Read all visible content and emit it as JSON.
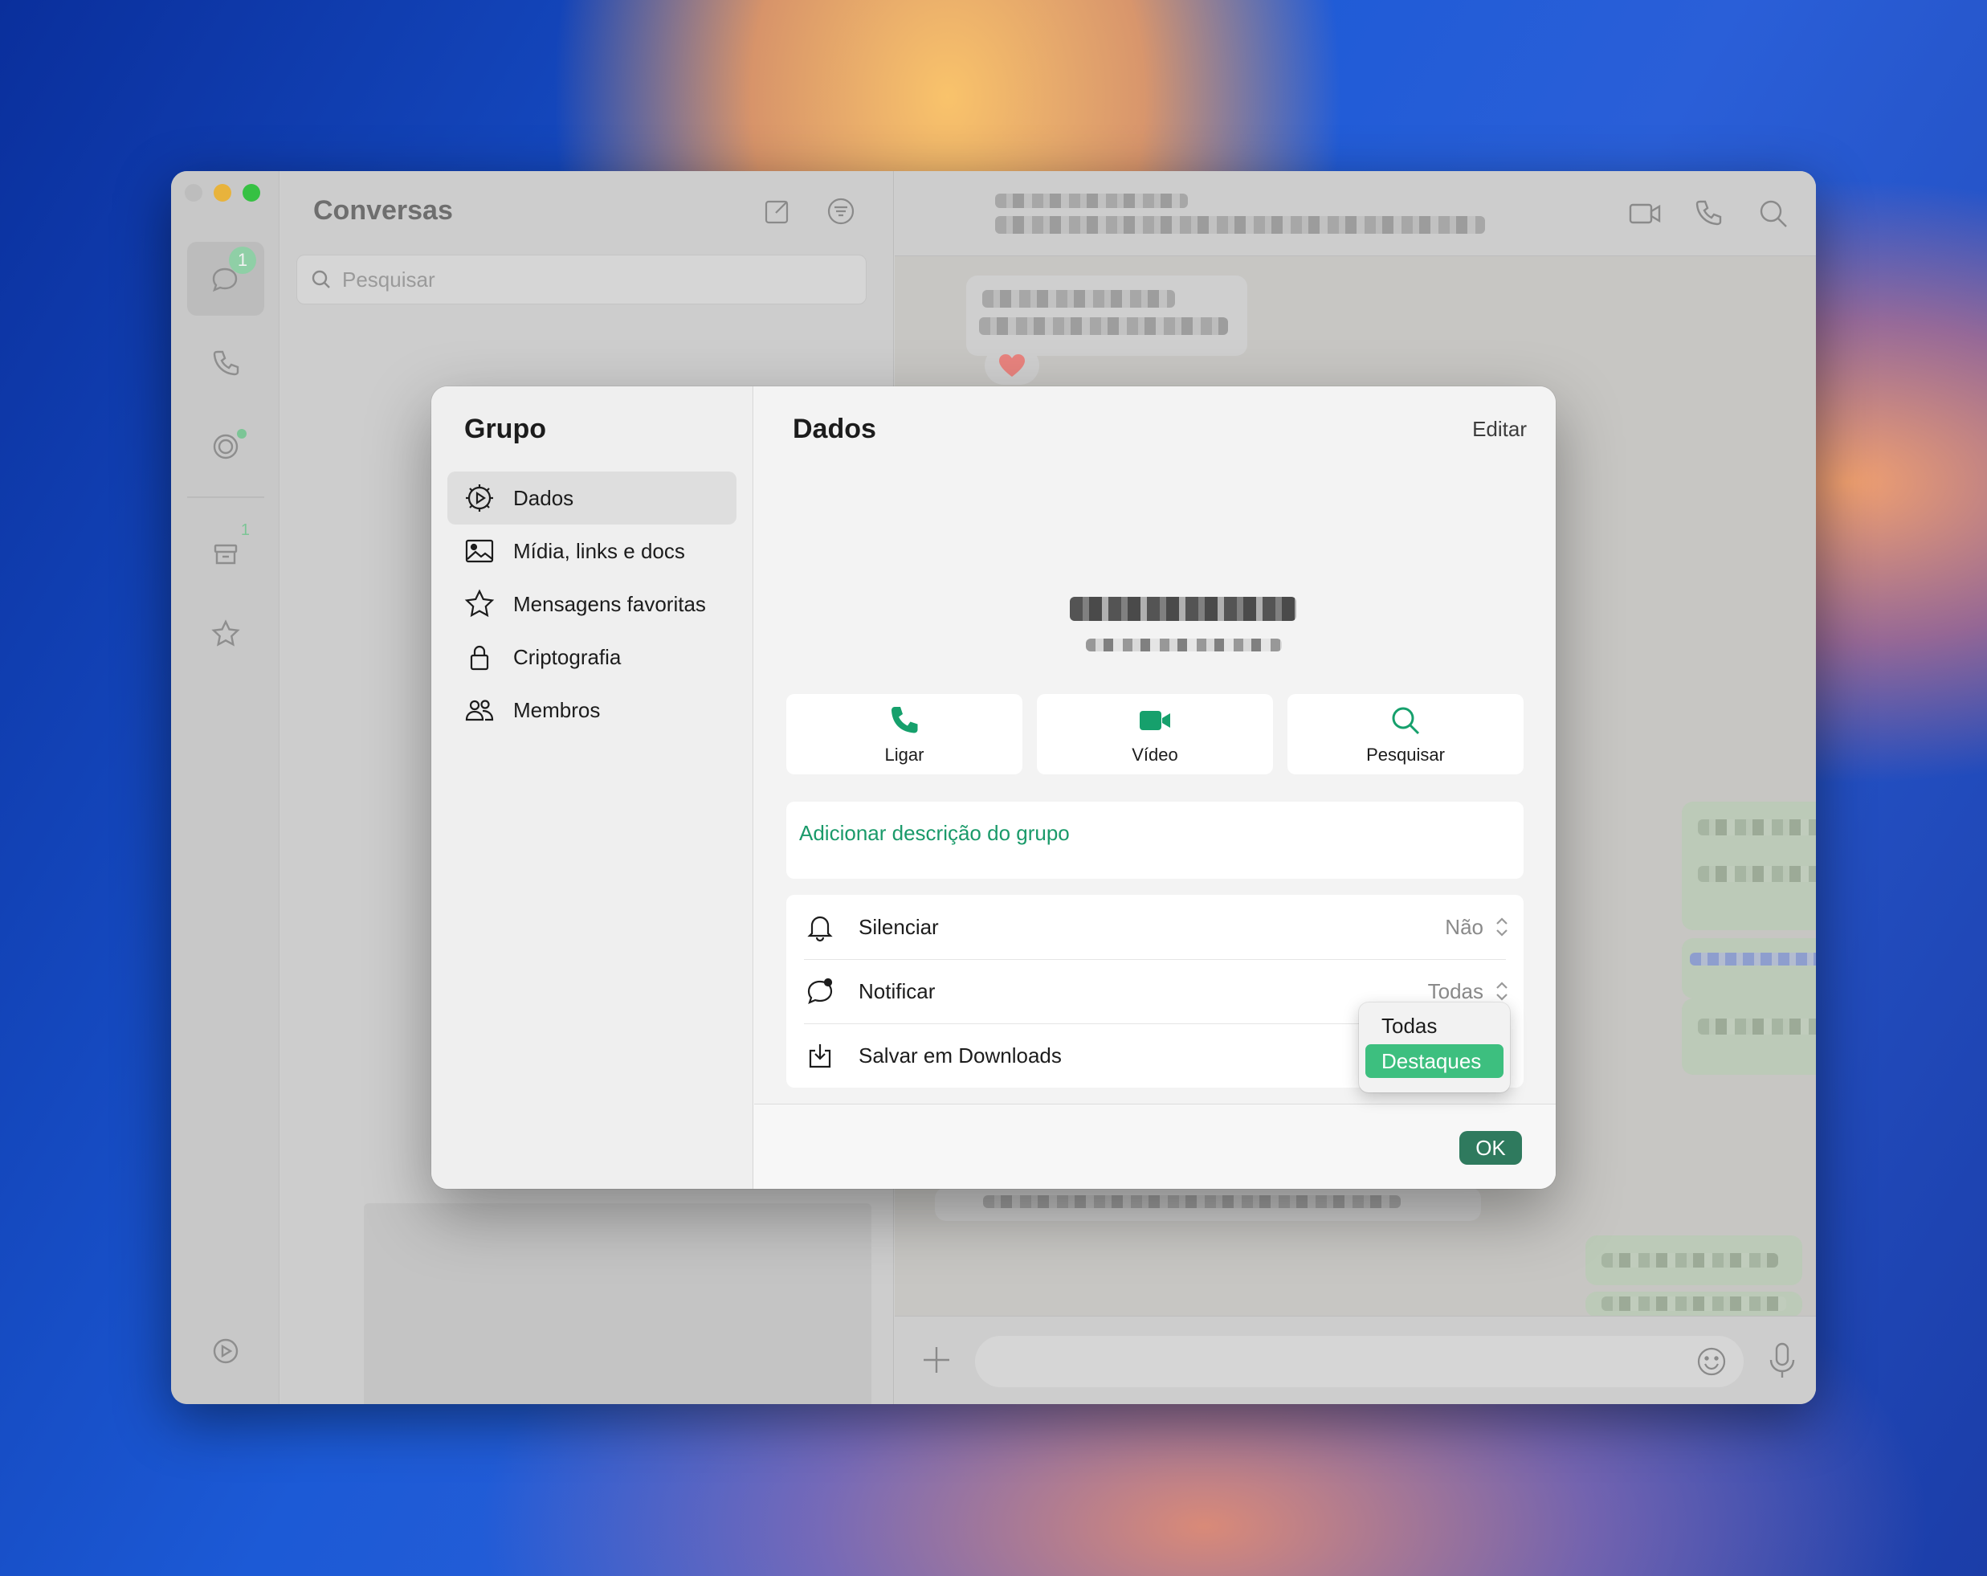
{
  "app": {
    "rail_badge": "1",
    "archive_count": "1"
  },
  "chatlist": {
    "title": "Conversas",
    "search_placeholder": "Pesquisar"
  },
  "modal": {
    "sidebar_title": "Grupo",
    "nav": [
      {
        "label": "Dados",
        "icon": "gear-icon",
        "active": true
      },
      {
        "label": "Mídia, links e docs",
        "icon": "image-icon"
      },
      {
        "label": "Mensagens favoritas",
        "icon": "star-icon"
      },
      {
        "label": "Criptografia",
        "icon": "lock-icon"
      },
      {
        "label": "Membros",
        "icon": "members-icon"
      }
    ],
    "title": "Dados",
    "edit_label": "Editar",
    "actions": [
      {
        "label": "Ligar",
        "icon": "phone-icon"
      },
      {
        "label": "Vídeo",
        "icon": "video-icon"
      },
      {
        "label": "Pesquisar",
        "icon": "search-icon"
      }
    ],
    "description_link": "Adicionar descrição do grupo",
    "settings": [
      {
        "label": "Silenciar",
        "value": "Não",
        "icon": "bell-icon"
      },
      {
        "label": "Notificar",
        "value": "Todas",
        "icon": "chat-bubble-icon"
      },
      {
        "label": "Salvar em Downloads",
        "value": "",
        "icon": "download-icon"
      }
    ],
    "ok_label": "OK",
    "popup_options": [
      "Todas",
      "Destaques"
    ],
    "popup_selected": "Destaques"
  },
  "colors": {
    "accent_green": "#1a9a6a",
    "selected_green": "#3dbf7f",
    "ok_button": "#2f7a5e"
  }
}
